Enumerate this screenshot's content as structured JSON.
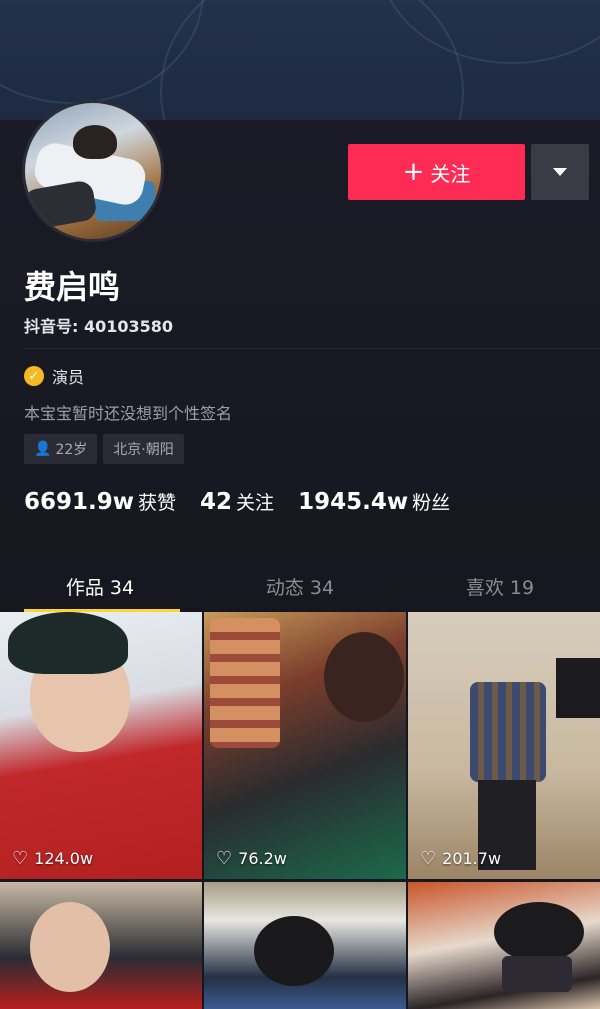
{
  "profile": {
    "name": "费启鸣",
    "douyin_id": "抖音号: 40103580",
    "verified_label": "演员",
    "bio": "本宝宝暂时还没想到个性签名",
    "tags": [
      {
        "icon": "person-icon",
        "text": "22岁"
      },
      {
        "text": "北京·朝阳"
      }
    ]
  },
  "actions": {
    "follow_plus": "+",
    "follow_label": "关注",
    "more_icon": "dropdown-triangle-icon"
  },
  "stats": [
    {
      "num": "6691.9w",
      "label": "获赞"
    },
    {
      "num": "42",
      "label": "关注"
    },
    {
      "num": "1945.4w",
      "label": "粉丝"
    }
  ],
  "tabs": [
    {
      "label": "作品 34"
    },
    {
      "label": "动态 34"
    },
    {
      "label": "喜欢 19"
    }
  ],
  "videos": [
    {
      "likes": "124.0w"
    },
    {
      "likes": "76.2w"
    },
    {
      "likes": "201.7w"
    },
    {
      "likes": ""
    },
    {
      "likes": ""
    },
    {
      "likes": ""
    }
  ],
  "colors": {
    "accent": "#fe2c55",
    "tab_indicator": "#fcd535",
    "verify_badge": "#f5b921"
  }
}
